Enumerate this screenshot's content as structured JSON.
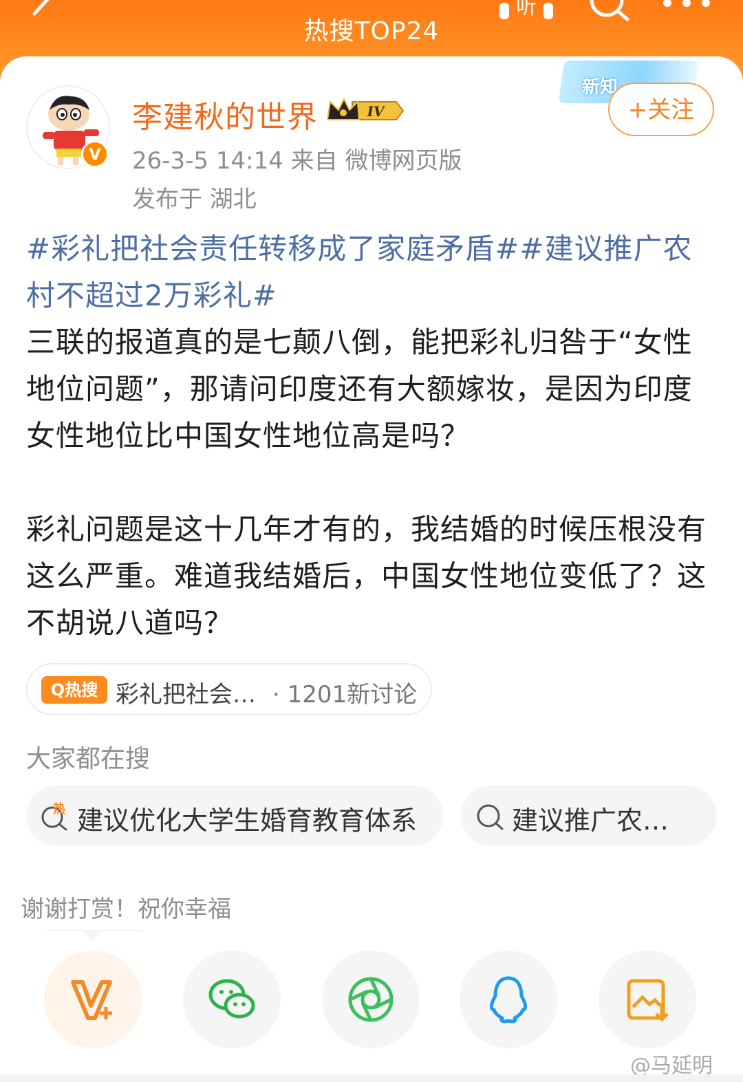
{
  "header": {
    "title": "热搜TOP24",
    "listen_label": "听"
  },
  "post": {
    "username": "李建秋的世界",
    "level": "IV",
    "verified_mark": "V",
    "meta": "26-3-5 14:14  来自 微博网页版",
    "location": "发布于 湖北",
    "banner_text": "新知",
    "follow_label": "+关注",
    "hashtags": "#彩礼把社会责任转移成了家庭矛盾##建议推广农村不超过2万彩礼#",
    "paragraph1": "三联的报道真的是七颠八倒，能把彩礼归咎于“女性地位问题”，那请问印度还有大额嫁妆，是因为印度女性地位比中国女性地位高是吗？",
    "paragraph2": "彩礼问题是这十几年才有的，我结婚的时候压根没有这么严重。难道我结婚后，中国女性地位变低了？这不胡说八道吗？"
  },
  "hot_topic": {
    "tag": "Q热搜",
    "text": "彩礼把社会…",
    "count": "· 1201新讨论"
  },
  "searches": {
    "heading": "大家都在搜",
    "items": [
      {
        "label": "建议优化大学生婚育教育体系",
        "hot_mark": "热"
      },
      {
        "label": "建议推广农…"
      }
    ]
  },
  "tip": {
    "text": "谢谢打赏！祝你幸福"
  },
  "share": {
    "icons": [
      "reward-v-plus-icon",
      "wechat-icon",
      "moments-icon",
      "qq-icon",
      "save-image-icon"
    ]
  },
  "watermark": "@马延明",
  "colors": {
    "brand_orange": "#ff8a1e",
    "username": "#f06a1a",
    "hashtag": "#4c6ea5",
    "wechat_green": "#2bb24c",
    "qq_blue": "#1e9bf0"
  }
}
